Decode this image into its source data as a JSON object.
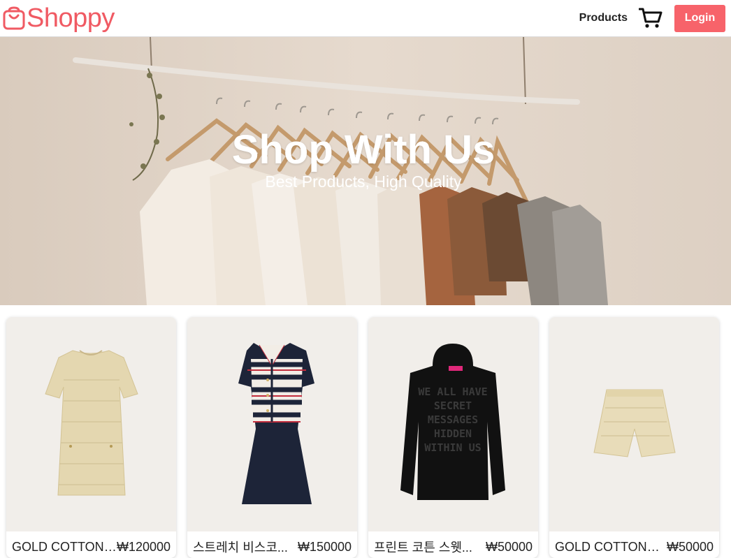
{
  "brand": {
    "name": "Shoppy",
    "icon": "shopping-bag-icon",
    "color": "#f05a63"
  },
  "nav": {
    "products_label": "Products",
    "cart_icon": "cart-icon",
    "login_label": "Login",
    "login_color": "#f7636a"
  },
  "hero": {
    "title": "Shop With Us",
    "subtitle": "Best Products, High Quality"
  },
  "products": [
    {
      "title": "GOLD COTTON T...",
      "price": "₩120000"
    },
    {
      "title": "스트레치 비스코...",
      "price": "₩150000"
    },
    {
      "title": "프린트 코튼 스웻...",
      "price": "₩50000"
    },
    {
      "title": "GOLD COTTON T...",
      "price": "₩50000"
    }
  ]
}
